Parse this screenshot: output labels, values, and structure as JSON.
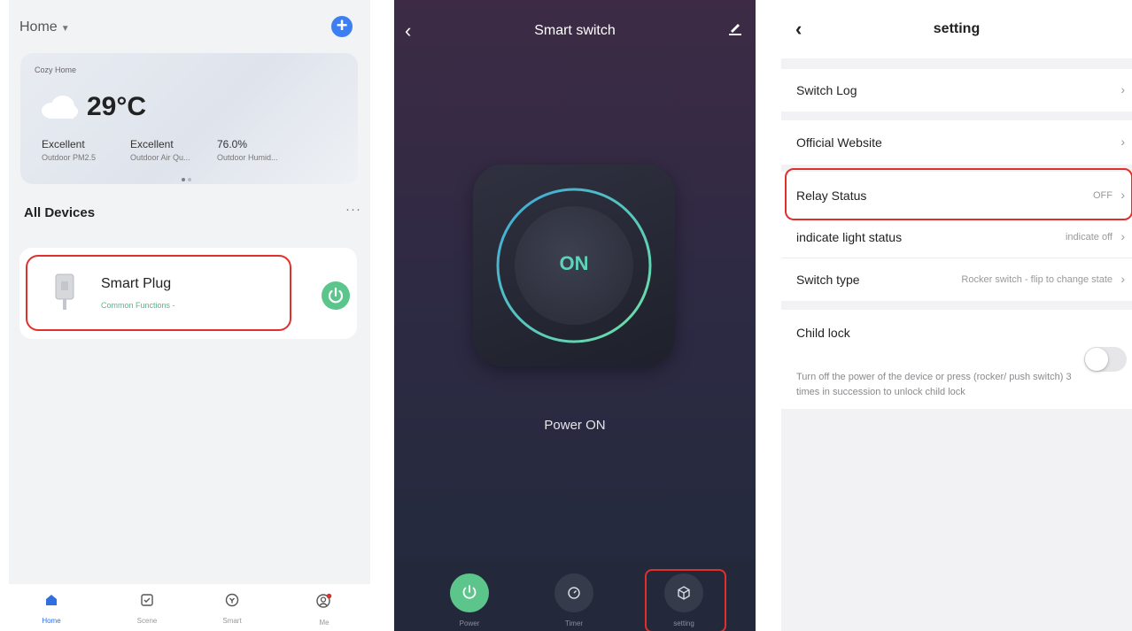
{
  "home": {
    "title": "Home",
    "add_icon": "plus-icon",
    "weather": {
      "home_name": "Cozy Home",
      "temperature": "29°C",
      "stats": [
        {
          "value": "Excellent",
          "label": "Outdoor PM2.5"
        },
        {
          "value": "Excellent",
          "label": "Outdoor Air Qu..."
        },
        {
          "value": "76.0%",
          "label": "Outdoor Humid..."
        }
      ]
    },
    "section_title": "All Devices",
    "more": "···",
    "device": {
      "name": "Smart Plug",
      "subtitle": "Common Functions -"
    },
    "tabs": [
      {
        "label": "Home",
        "icon": "home-icon"
      },
      {
        "label": "Scene",
        "icon": "scene-icon"
      },
      {
        "label": "Smart",
        "icon": "smart-icon"
      },
      {
        "label": "Me",
        "icon": "me-icon"
      }
    ]
  },
  "switch": {
    "title": "Smart switch",
    "state": "ON",
    "status": "Power ON",
    "controls": [
      {
        "label": "Power",
        "icon": "power-icon"
      },
      {
        "label": "Timer",
        "icon": "timer-icon"
      },
      {
        "label": "setting",
        "icon": "setting-icon"
      }
    ]
  },
  "setting": {
    "title": "setting",
    "rows": {
      "switch_log": {
        "label": "Switch Log"
      },
      "official_website": {
        "label": "Official Website"
      },
      "relay_status": {
        "label": "Relay Status",
        "value": "OFF"
      },
      "indicate_light": {
        "label": "indicate light status",
        "value": "indicate off"
      },
      "switch_type": {
        "label": "Switch type",
        "value": "Rocker switch - flip to change state"
      },
      "child_lock": {
        "label": "Child lock",
        "description": "Turn off the power of the device or press (rocker/ push switch) 3 times in succession to unlock child lock",
        "enabled": false
      }
    }
  },
  "colors": {
    "accent_blue": "#3d7ef3",
    "power_green": "#5cc58c",
    "highlight_red": "#e0302c",
    "on_teal": "#5fd3b8"
  }
}
